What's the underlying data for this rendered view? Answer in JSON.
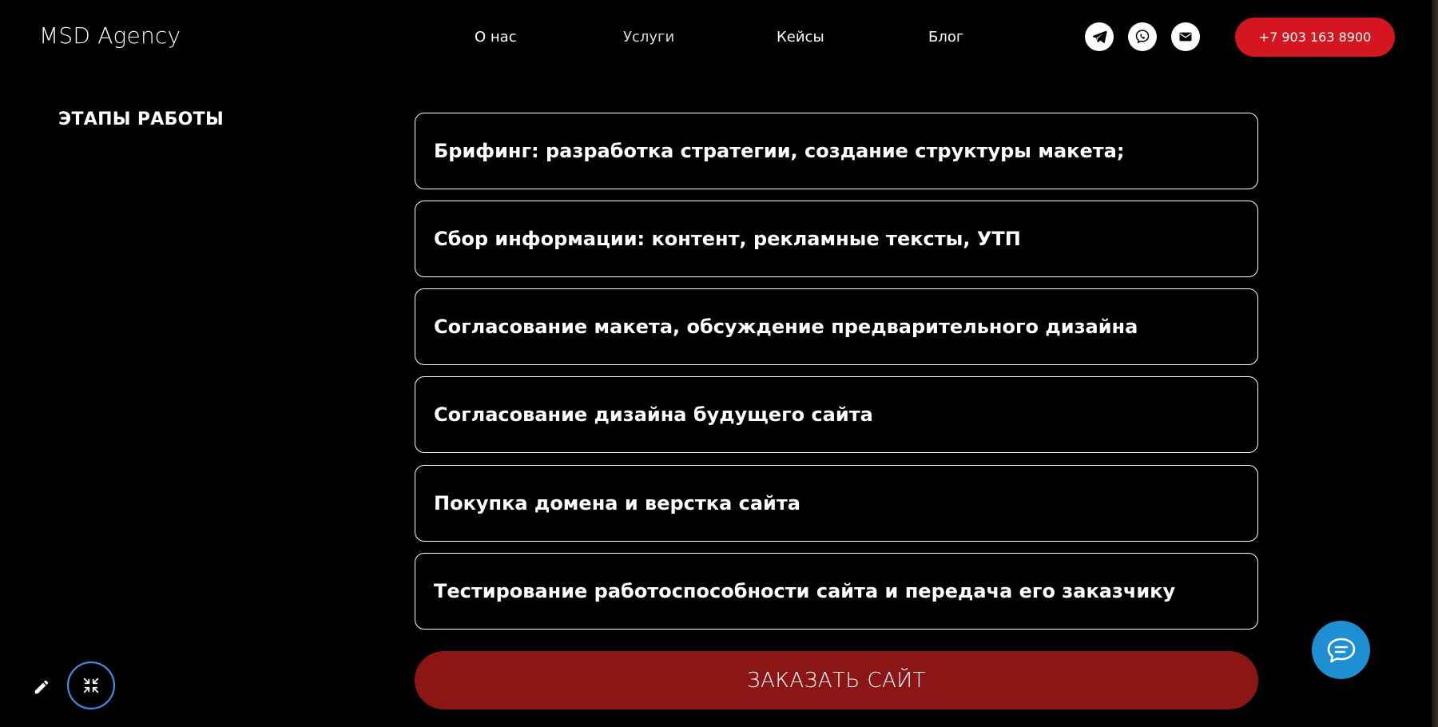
{
  "header": {
    "logo": "MSD Agency",
    "nav": [
      {
        "label": "О нас"
      },
      {
        "label": "Услуги"
      },
      {
        "label": "Кейсы"
      },
      {
        "label": "Блог"
      }
    ],
    "social_icons": [
      "telegram-icon",
      "viber-icon",
      "mail-icon"
    ],
    "phone_label": "+7 903 163 8900"
  },
  "section": {
    "title": "ЭТАПЫ РАБОТЫ",
    "steps": [
      {
        "text": "Брифинг: разработка стратегии, создание структуры макета;"
      },
      {
        "text": "Сбор информации: контент, рекламные тексты, УТП"
      },
      {
        "text": "Согласование макета, обсуждение предварительного дизайна"
      },
      {
        "text": "Согласование дизайна будущего сайта"
      },
      {
        "text": "Покупка домена и верстка сайта"
      },
      {
        "text": "Тестирование работоспособности сайта и передача его заказчику"
      }
    ],
    "order_button": "ЗАКАЗАТЬ САЙТ"
  },
  "colors": {
    "background": "#000000",
    "accent_red": "#d3161f",
    "order_button": "#8c1616",
    "chat_blue": "#1f8fd3"
  },
  "floating": {
    "chat_icon": "chat-bubble-icon",
    "edit_icon": "pencil-icon",
    "minimize_icon": "collapse-icon"
  }
}
